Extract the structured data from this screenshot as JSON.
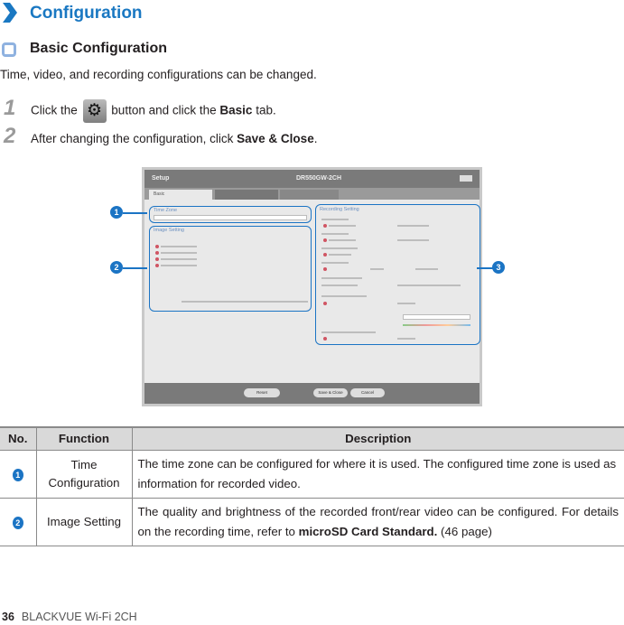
{
  "header": {
    "title": "Configuration",
    "subtitle": "Basic Configuration",
    "intro": "Time, video, and recording configurations can be changed."
  },
  "steps": [
    {
      "num": "1",
      "pre": "Click the",
      "icon": "gear-icon",
      "mid": "button and click the",
      "bold": "Basic",
      "post": "tab."
    },
    {
      "num": "2",
      "pre": "After changing the configuration, click",
      "bold": "Save & Close",
      "post": "."
    }
  ],
  "screenshot": {
    "app_title": "Setup",
    "model": "DR550GW-2CH",
    "tabs": [
      "Basic"
    ],
    "panels": [
      "Time Zone",
      "Image Setting",
      "Recording Setting"
    ],
    "buttons": [
      "Reset",
      "Save & Close",
      "Cancel"
    ],
    "accent": "#1b74c4"
  },
  "callouts": [
    "1",
    "2",
    "3"
  ],
  "table": {
    "headers": [
      "No.",
      "Function",
      "Description"
    ],
    "rows": [
      {
        "no": "1",
        "function": "Time Configuration",
        "description": "The time zone can be configured for where it is used. The configured time zone is used as information for recorded video."
      },
      {
        "no": "2",
        "function": "Image Setting",
        "description_pre": "The quality and brightness of the recorded front/rear video can be configured. For details on the recording time, refer to",
        "description_bold": "microSD Card Standard.",
        "description_post": "(46 page)"
      }
    ]
  },
  "footer": {
    "page": "36",
    "product": "BLACKVUE Wi-Fi 2CH"
  }
}
